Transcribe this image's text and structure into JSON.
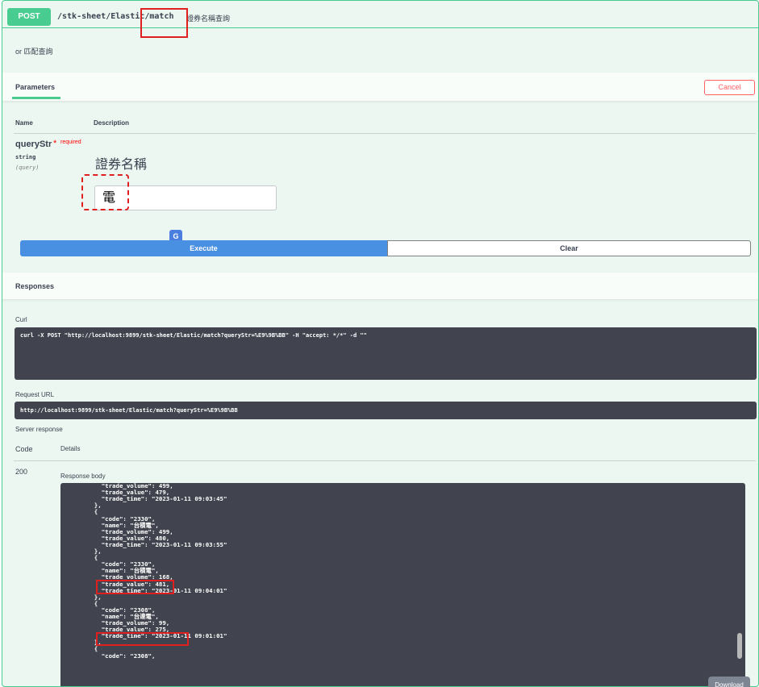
{
  "operation": {
    "method": "POST",
    "path": "/stk-sheet/Elastic/match",
    "summary": "證券名稱查詢",
    "description": "or 匹配查詢"
  },
  "parameters_section": {
    "title": "Parameters",
    "cancel_label": "Cancel",
    "col_name": "Name",
    "col_description": "Description",
    "param": {
      "name": "queryStr",
      "required_star": "*",
      "required_label": "required",
      "type": "string",
      "in": "(query)",
      "description": "證券名稱",
      "value": "電"
    },
    "translate_icon_glyph": "G",
    "execute_label": "Execute",
    "clear_label": "Clear"
  },
  "responses_section": {
    "title": "Responses",
    "curl_label": "Curl",
    "curl_command": "curl -X POST \"http://localhost:9899/stk-sheet/Elastic/match?queryStr=%E9%9B%BB\" -H \"accept: */*\" -d \"\"",
    "request_url_label": "Request URL",
    "request_url": "http://localhost:9899/stk-sheet/Elastic/match?queryStr=%E9%9B%BB",
    "server_response_label": "Server response",
    "col_code": "Code",
    "col_details": "Details",
    "status_code": "200",
    "response_body_label": "Response body",
    "response_body": "      \"name\": \"台積電\",\n      \"trade_volume\": 499,\n      \"trade_value\": 479,\n      \"trade_time\": \"2023-01-11 09:03:45\"\n    },\n    {\n      \"code\": \"2330\",\n      \"name\": \"台積電\",\n      \"trade_volume\": 499,\n      \"trade_value\": 480,\n      \"trade_time\": \"2023-01-11 09:03:55\"\n    },\n    {\n      \"code\": \"2330\",\n      \"name\": \"台積電\",\n      \"trade_volume\": 168,\n      \"trade_value\": 481,\n      \"trade_time\": \"2023-01-11 09:04:01\"\n    },\n    {\n      \"code\": \"2308\",\n      \"name\": \"台達電\",\n      \"trade_volume\": 99,\n      \"trade_value\": 275,\n      \"trade_time\": \"2023-01-11 09:01:01\"\n    },\n    {\n      \"code\": \"2308\",",
    "download_label": "Download"
  },
  "colors": {
    "post_green": "#49cc90",
    "execute_blue": "#4990e2",
    "cancel_red": "#ff6060",
    "code_bg": "#41444e",
    "annotation_red": "#e02020"
  }
}
